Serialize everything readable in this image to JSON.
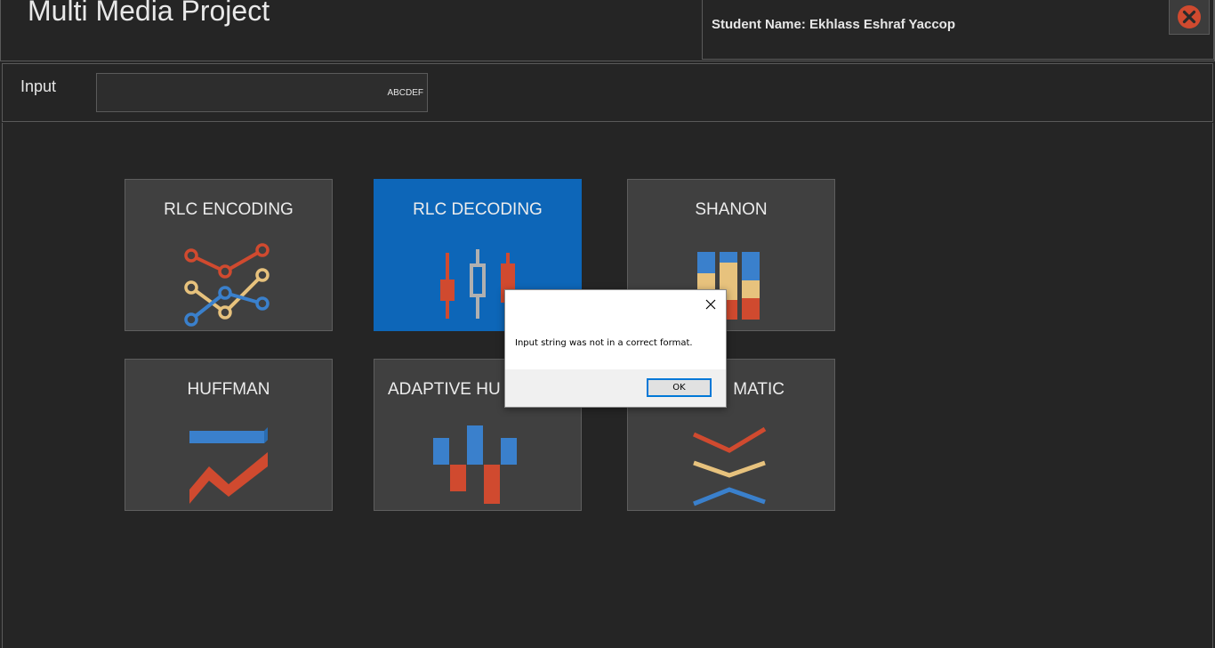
{
  "app": {
    "title": "Multi Media Project"
  },
  "student": {
    "label": "Student Name:",
    "name": "Ekhlass Eshraf Yaccop"
  },
  "close_button": {
    "icon": "close-circle-icon",
    "color": "#d04a2f"
  },
  "input": {
    "label": "Input",
    "value": "ABCDEF"
  },
  "tiles": [
    {
      "label": "RLC ENCODING",
      "icon": "line-chart-icon",
      "active": false
    },
    {
      "label": "RLC DECODING",
      "icon": "candlestick-chart-icon",
      "active": true
    },
    {
      "label": "SHANON",
      "icon": "stacked-bar-chart-icon",
      "active": false
    },
    {
      "label": "HUFFMAN",
      "icon": "area-chart-icon",
      "active": false
    },
    {
      "label": "ADAPTIVE HU",
      "icon": "waterfall-chart-icon",
      "active": false
    },
    {
      "label": "MATIC",
      "icon": "chevron-lines-icon",
      "active": false
    }
  ],
  "dialog": {
    "message": "Input string was not in a correct format.",
    "ok_label": "OK"
  },
  "colors": {
    "background": "#252525",
    "tile": "#404040",
    "tile_active": "#0d66b8",
    "red": "#d04a2f",
    "yellow": "#e7c27d",
    "blue": "#3a80cc"
  }
}
